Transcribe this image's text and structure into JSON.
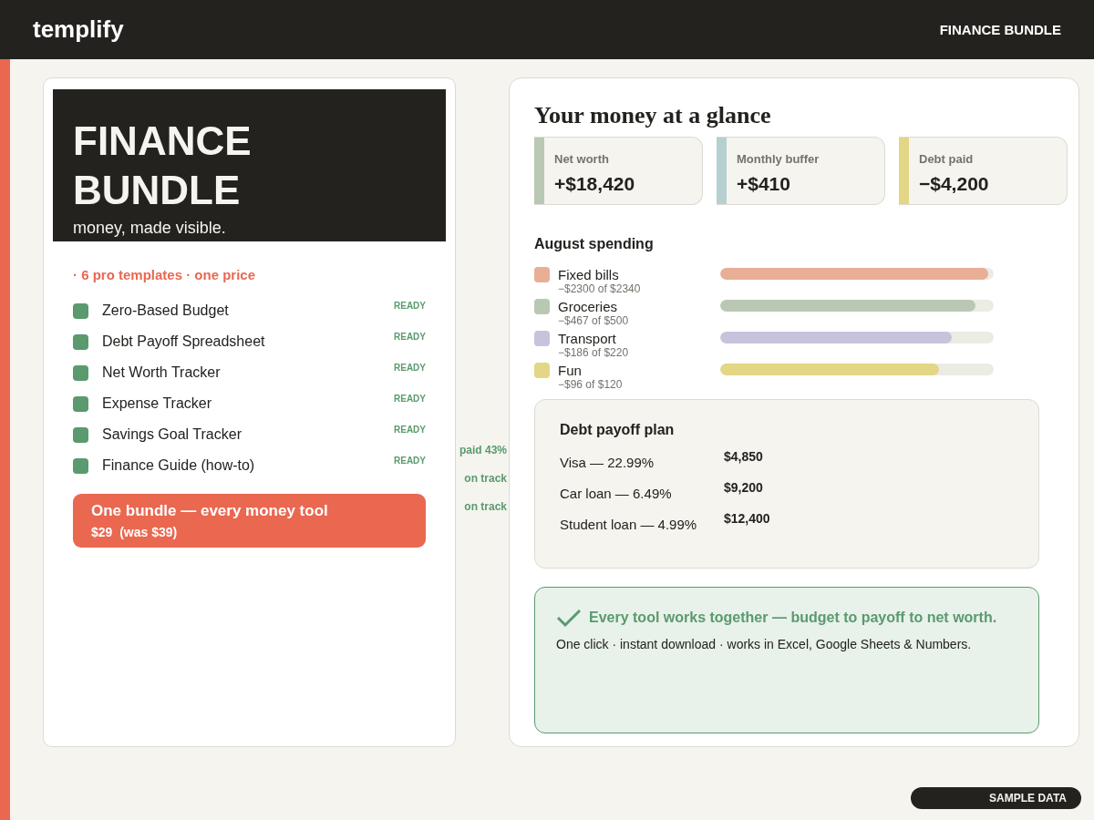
{
  "header": {
    "logo": "templify",
    "nav": "FINANCE BUNDLE"
  },
  "hero": {
    "title": "FINANCE BUNDLE",
    "tagline": "money, made visible."
  },
  "offer_line": "· 6 pro templates · one price",
  "templates": [
    {
      "name": "Zero-Based Budget",
      "status": "READY"
    },
    {
      "name": "Debt Payoff Spreadsheet",
      "status": "READY"
    },
    {
      "name": "Net Worth Tracker",
      "status": "READY"
    },
    {
      "name": "Expense Tracker",
      "status": "READY"
    },
    {
      "name": "Savings Goal Tracker",
      "status": "READY"
    },
    {
      "name": "Finance Guide (how-to)",
      "status": "READY"
    }
  ],
  "cta": {
    "title": "One bundle — every money tool",
    "price": "$29  (was $39)"
  },
  "side_notes": [
    "paid 43%",
    "on track",
    "on track"
  ],
  "overview": {
    "title": "Your money at a glance",
    "stats": [
      {
        "label": "Net worth",
        "value": "+$18,420",
        "color": "#b9c8b3"
      },
      {
        "label": "Monthly buffer",
        "value": "+$410",
        "color": "#b5d0cf"
      },
      {
        "label": "Debt paid",
        "value": "−$4,200",
        "color": "#e3d685"
      }
    ],
    "spending_title": "August spending",
    "spending": [
      {
        "name": "Fixed bills",
        "amount": "−$2300 of $2340",
        "color": "#e8ae96",
        "level": 0.98
      },
      {
        "name": "Groceries",
        "amount": "−$467 of $500",
        "color": "#b9c8b3",
        "level": 0.934
      },
      {
        "name": "Transport",
        "amount": "−$186 of $220",
        "color": "#c8c2dc",
        "level": 0.845
      },
      {
        "name": "Fun",
        "amount": "−$96 of $120",
        "color": "#e3d685",
        "level": 0.8
      }
    ],
    "debt": {
      "title": "Debt payoff plan",
      "rows": [
        {
          "name": "Visa — 22.99%",
          "amount": "$4,850"
        },
        {
          "name": "Car loan — 6.49%",
          "amount": "$9,200"
        },
        {
          "name": "Student loan — 4.99%",
          "amount": "$12,400"
        }
      ]
    },
    "promo": {
      "headline": "Every tool works together — budget to payoff to net worth.",
      "text": "One click · instant download · works in Excel, Google Sheets & Numbers."
    }
  },
  "badge": "SAMPLE DATA"
}
